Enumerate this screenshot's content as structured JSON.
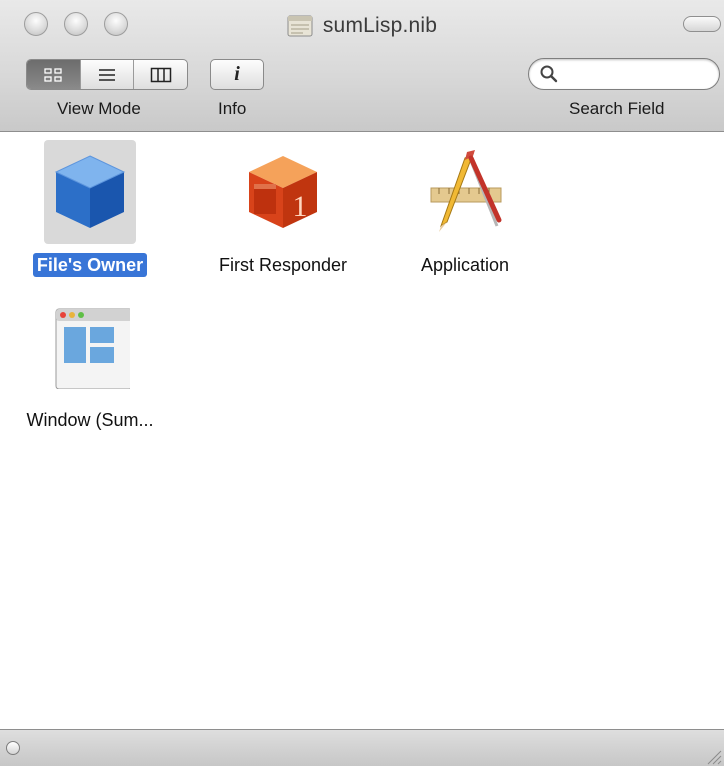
{
  "window": {
    "title": "sumLisp.nib",
    "controls": [
      "close",
      "minimize",
      "zoom"
    ]
  },
  "toolbar": {
    "view_mode_label": "View Mode",
    "view_mode_options": [
      "icon-view",
      "list-view",
      "column-view"
    ],
    "view_mode_selected": "icon-view",
    "info_label": "Info",
    "info_glyph": "i",
    "search_label": "Search Field",
    "search_value": ""
  },
  "items": [
    {
      "label": "File's Owner",
      "icon": "blue-cube-icon",
      "selected": true
    },
    {
      "label": "First Responder",
      "icon": "red-cube-icon",
      "selected": false
    },
    {
      "label": "Application",
      "icon": "app-pencil-icon",
      "selected": false
    },
    {
      "label": "Window (Sum...",
      "icon": "window-icon",
      "selected": false
    }
  ],
  "colors": {
    "selection": "#3875d7",
    "toolbar_top": "#e9e9e9",
    "toolbar_bottom": "#c9c9c9"
  }
}
